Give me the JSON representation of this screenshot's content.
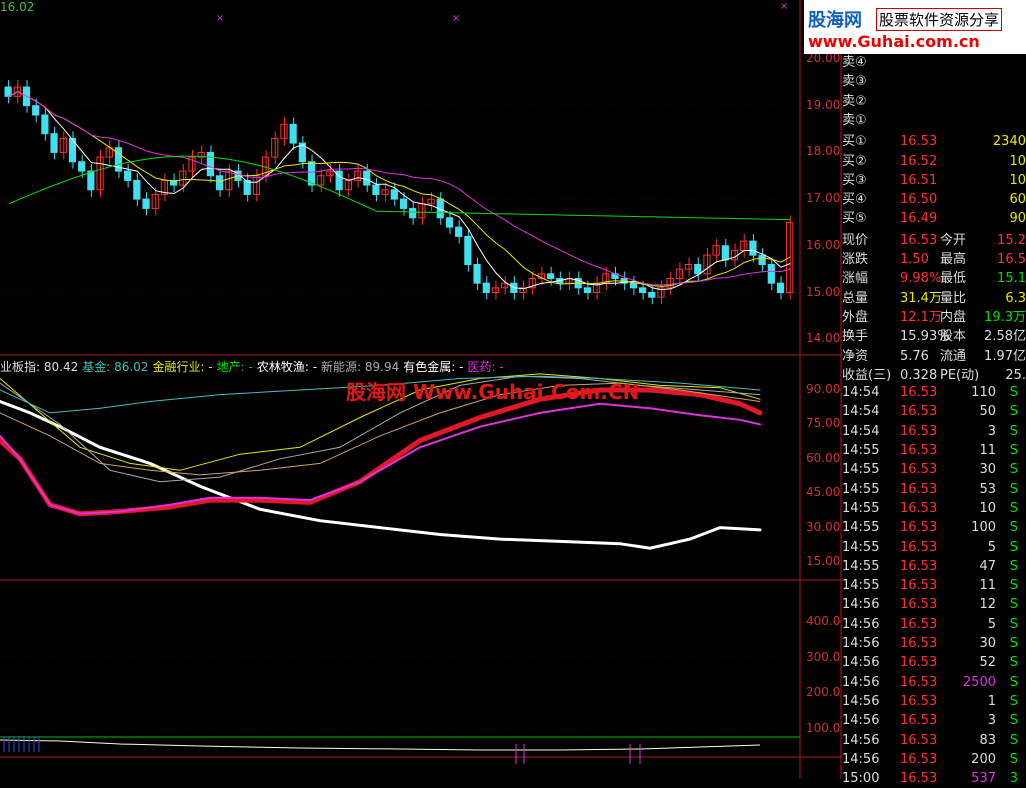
{
  "top_left_price": "16.02",
  "watermark_logo": {
    "brand": "股海网",
    "slogan": "股票软件资源分享",
    "url": "www.Guhai.com.cn"
  },
  "watermark_center": "股海网 Www.Guhai.Com.CN",
  "price_axis": [
    "20.00",
    "19.00",
    "18.00",
    "17.00",
    "16.00",
    "15.00",
    "14.00"
  ],
  "indicator_axis": [
    "90.00",
    "75.00",
    "60.00",
    "45.00",
    "30.00",
    "15.00"
  ],
  "volume_axis": [
    "400.0",
    "300.0",
    "200.0",
    "100.0"
  ],
  "indicator_legend": [
    {
      "text": "业板指: 80.42",
      "color": "#dddddd"
    },
    {
      "text": "基金: 86.02",
      "color": "#40c0c0"
    },
    {
      "text": "金融行业: -",
      "color": "#e8e800"
    },
    {
      "text": "地产: -",
      "color": "#00e000"
    },
    {
      "text": "农林牧渔: -",
      "color": "#ffffff"
    },
    {
      "text": "新能源: 89.94",
      "color": "#aaaaaa"
    },
    {
      "text": "有色金属: -",
      "color": "#ffffff"
    },
    {
      "text": "医药: -",
      "color": "#e030e0"
    }
  ],
  "order_book": {
    "sell": [
      {
        "label": "卖④",
        "price": "",
        "vol": ""
      },
      {
        "label": "卖③",
        "price": "",
        "vol": ""
      },
      {
        "label": "卖②",
        "price": "",
        "vol": ""
      },
      {
        "label": "卖①",
        "price": "",
        "vol": ""
      }
    ],
    "buy": [
      {
        "label": "买①",
        "price": "16.53",
        "vol": "2340"
      },
      {
        "label": "买②",
        "price": "16.52",
        "vol": "10"
      },
      {
        "label": "买③",
        "price": "16.51",
        "vol": "10"
      },
      {
        "label": "买④",
        "price": "16.50",
        "vol": "60"
      },
      {
        "label": "买⑤",
        "price": "16.49",
        "vol": "90"
      }
    ]
  },
  "quote": [
    {
      "l1": "现价",
      "v1": "16.53",
      "l2": "今开",
      "v2": "15.2"
    },
    {
      "l1": "涨跌",
      "v1": "1.50",
      "l2": "最高",
      "v2": "16.5"
    },
    {
      "l1": "涨幅",
      "v1": "9.98%",
      "l2": "最低",
      "v2": "15.1"
    },
    {
      "l1": "总量",
      "v1": "31.4万",
      "l2": "量比",
      "v2": "6.3"
    },
    {
      "l1": "外盘",
      "v1": "12.1万",
      "l2": "内盘",
      "v2": "19.3万"
    },
    {
      "l1": "换手",
      "v1": "15.93%",
      "l2": "股本",
      "v2": "2.58亿"
    },
    {
      "l1": "净资",
      "v1": "5.76",
      "l2": "流通",
      "v2": "1.97亿"
    },
    {
      "l1": "收益(三)",
      "v1": "0.328",
      "l2": "PE(动)",
      "v2": "25."
    }
  ],
  "ticks": [
    {
      "time": "14:54",
      "price": "16.53",
      "vol": "110",
      "side": "S"
    },
    {
      "time": "14:54",
      "price": "16.53",
      "vol": "50",
      "side": "S"
    },
    {
      "time": "14:54",
      "price": "16.53",
      "vol": "3",
      "side": "S"
    },
    {
      "time": "14:55",
      "price": "16.53",
      "vol": "11",
      "side": "S"
    },
    {
      "time": "14:55",
      "price": "16.53",
      "vol": "30",
      "side": "S"
    },
    {
      "time": "14:55",
      "price": "16.53",
      "vol": "53",
      "side": "S"
    },
    {
      "time": "14:55",
      "price": "16.53",
      "vol": "10",
      "side": "S"
    },
    {
      "time": "14:55",
      "price": "16.53",
      "vol": "100",
      "side": "S"
    },
    {
      "time": "14:55",
      "price": "16.53",
      "vol": "5",
      "side": "S"
    },
    {
      "time": "14:55",
      "price": "16.53",
      "vol": "47",
      "side": "S"
    },
    {
      "time": "14:55",
      "price": "16.53",
      "vol": "11",
      "side": "S"
    },
    {
      "time": "14:56",
      "price": "16.53",
      "vol": "12",
      "side": "S"
    },
    {
      "time": "14:56",
      "price": "16.53",
      "vol": "5",
      "side": "S"
    },
    {
      "time": "14:56",
      "price": "16.53",
      "vol": "30",
      "side": "S"
    },
    {
      "time": "14:56",
      "price": "16.53",
      "vol": "52",
      "side": "S"
    },
    {
      "time": "14:56",
      "price": "16.53",
      "vol": "2500",
      "side": "S"
    },
    {
      "time": "14:56",
      "price": "16.53",
      "vol": "1",
      "side": "S"
    },
    {
      "time": "14:56",
      "price": "16.53",
      "vol": "3",
      "side": "S"
    },
    {
      "time": "14:56",
      "price": "16.53",
      "vol": "83",
      "side": "S"
    },
    {
      "time": "14:56",
      "price": "16.53",
      "vol": "200",
      "side": "S"
    },
    {
      "time": "15:00",
      "price": "16.53",
      "vol": "537",
      "side": "3"
    }
  ],
  "colors": {
    "up": "#ff3030",
    "down": "#40e0f0",
    "axis": "#b01818",
    "ma5": "#ffffff",
    "ma10": "#e8e800",
    "ma20": "#e030e0",
    "ma60": "#00e000"
  }
}
